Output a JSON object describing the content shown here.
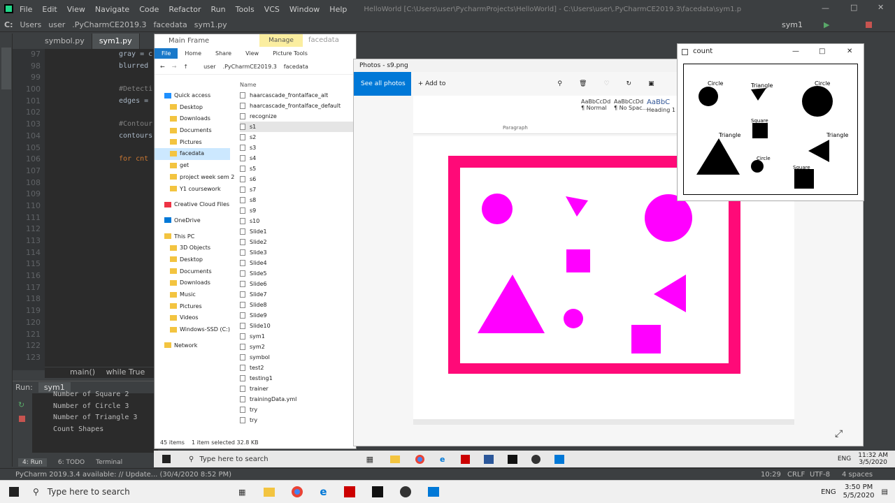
{
  "pycharm": {
    "menu": [
      "File",
      "Edit",
      "View",
      "Navigate",
      "Code",
      "Refactor",
      "Run",
      "Tools",
      "VCS",
      "Window",
      "Help"
    ],
    "title": "HelloWorld [C:\\Users\\user\\PycharmProjects\\HelloWorld] - C:\\Users\\user\\.PyCharmCE2019.3\\facedata\\sym1.py - PyCharm",
    "breadcrumb": [
      "C:",
      "Users",
      "user",
      ".PyCharmCE2019.3",
      "facedata",
      "sym1.py"
    ],
    "run_config": "sym1",
    "tabs": [
      "symbol.py",
      "sym1.py"
    ],
    "line_numbers": [
      "97",
      "98",
      "99",
      "100",
      "101",
      "102",
      "103",
      "104",
      "105",
      "106",
      "107",
      "108",
      "109",
      "110",
      "111",
      "112",
      "113",
      "114",
      "115",
      "116",
      "117",
      "118",
      "119",
      "120",
      "121",
      "122",
      "123"
    ],
    "code_lines": [
      "gray = c",
      "blurred",
      "",
      "#Detecti",
      "edges =",
      "",
      "#Contour",
      "contours",
      "",
      "for cnt",
      "",
      "",
      "",
      "",
      "",
      "",
      "",
      "",
      "",
      "",
      "",
      "",
      "",
      "",
      "",
      "",
      ""
    ],
    "code_crumb": [
      "main()",
      "while True"
    ],
    "run_label": "Run:",
    "run_tab": "sym1",
    "output": [
      "Number of Square 2",
      "Number of Circle 3",
      "Number of Triangle 3",
      "Count Shapes"
    ],
    "bottom_tabs": [
      "4: Run",
      "6: TODO",
      "Terminal"
    ],
    "status_left": "PyCharm 2019.3.4 available: // Update... (30/4/2020 8:52 PM)",
    "status_right": [
      "10:29",
      "CRLF",
      "UTF-8",
      "4 spaces"
    ]
  },
  "explorer": {
    "title": "Main Frame",
    "manage": "Manage",
    "folder_title": "facedata",
    "ribbon": [
      "File",
      "Home",
      "Share",
      "View",
      "Picture Tools"
    ],
    "address": [
      "user",
      ".PyCharmCE2019.3",
      "facedata"
    ],
    "nav": [
      "Quick access",
      "Desktop",
      "Downloads",
      "Documents",
      "Pictures",
      "facedata",
      "get",
      "project week sem 2",
      "Y1 coursework",
      "Creative Cloud Files",
      "OneDrive",
      "This PC",
      "3D Objects",
      "Desktop",
      "Documents",
      "Downloads",
      "Music",
      "Pictures",
      "Videos",
      "Windows-SSD (C:)",
      "Network"
    ],
    "column_header": "Name",
    "files": [
      "haarcascade_frontalface_alt",
      "haarcascade_frontalface_default",
      "recognize",
      "s1",
      "s2",
      "s3",
      "s4",
      "s5",
      "s6",
      "s7",
      "s8",
      "s9",
      "s10",
      "Slide1",
      "Slide2",
      "Slide3",
      "Slide4",
      "Slide5",
      "Slide6",
      "Slide7",
      "Slide8",
      "Slide9",
      "Slide10",
      "sym1",
      "sym2",
      "symbol",
      "test2",
      "testing1",
      "trainer",
      "trainingData.yml",
      "try",
      "try"
    ],
    "item_count": "45 items",
    "selected": "1 item selected  32.8 KB"
  },
  "photos": {
    "title": "Photos - s9.png",
    "see_all": "See all photos",
    "add_to": "Add to",
    "styles": [
      "AaBbCcDd",
      "AaBbCcDd",
      "AaBbC"
    ],
    "style_names": [
      "¶ Normal",
      "¶ No Spac...",
      "Heading 1"
    ],
    "paragraph": "Paragraph",
    "shape_color": "#ff00ff",
    "frame_color": "#ff0a78"
  },
  "count_window": {
    "title": "count",
    "labels": [
      "Circle",
      "Triangle",
      "Circle",
      "Square",
      "Triangle",
      "Triangle",
      "Circle",
      "Square"
    ]
  },
  "inner_taskbar": {
    "search": "Type here to search",
    "time": "11:32 AM",
    "date": "3/5/2020",
    "lang": "ENG"
  },
  "taskbar": {
    "search": "Type here to search",
    "time": "3:50 PM",
    "date": "5/5/2020",
    "lang": "ENG"
  }
}
